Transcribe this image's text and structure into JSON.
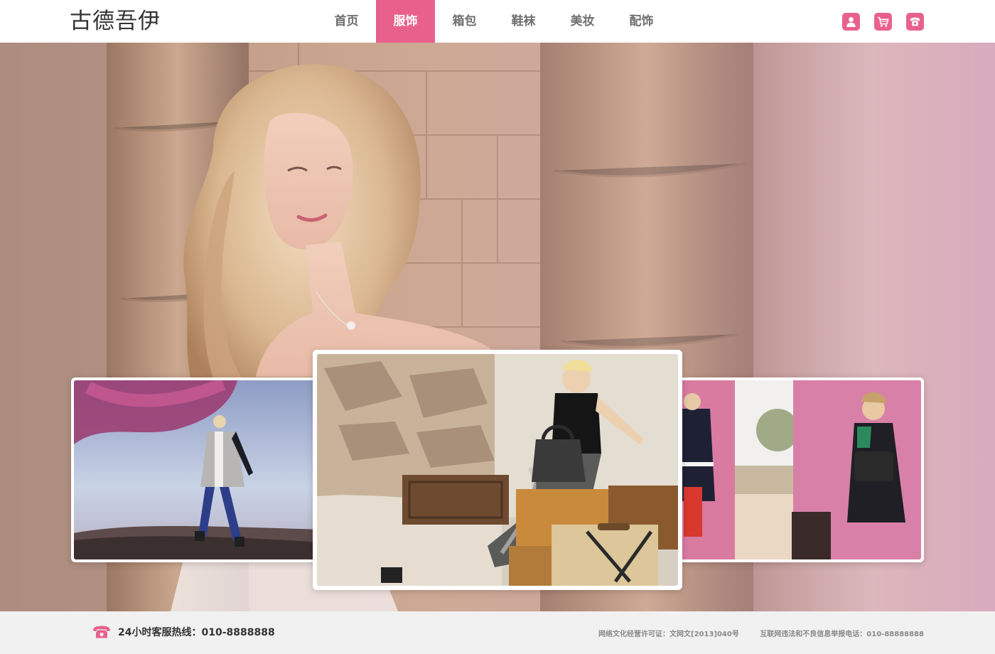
{
  "brand": {
    "logo_text": "古德吾伊"
  },
  "nav": {
    "items": [
      {
        "label": "首页",
        "active": false
      },
      {
        "label": "服饰",
        "active": true
      },
      {
        "label": "箱包",
        "active": false
      },
      {
        "label": "鞋袜",
        "active": false
      },
      {
        "label": "美妆",
        "active": false
      },
      {
        "label": "配饰",
        "active": false
      }
    ]
  },
  "header_icons": [
    "user-icon",
    "cart-icon",
    "phone-icon"
  ],
  "carousel": {
    "slides": [
      {
        "position": "left",
        "subject": "model-pink-tree"
      },
      {
        "position": "center",
        "subject": "model-with-luggage"
      },
      {
        "position": "right",
        "subject": "models-pink-wall"
      }
    ]
  },
  "footer": {
    "hotline": "24小时客服热线：010-8888888",
    "license": "网络文化经营许可证：文网文[2013]040号",
    "report": "互联网违法和不良信息举报电话：010-88888888"
  },
  "colors": {
    "accent": "#e8618c",
    "header_bg": "#ffffff",
    "footer_bg": "#f1f1f1"
  }
}
